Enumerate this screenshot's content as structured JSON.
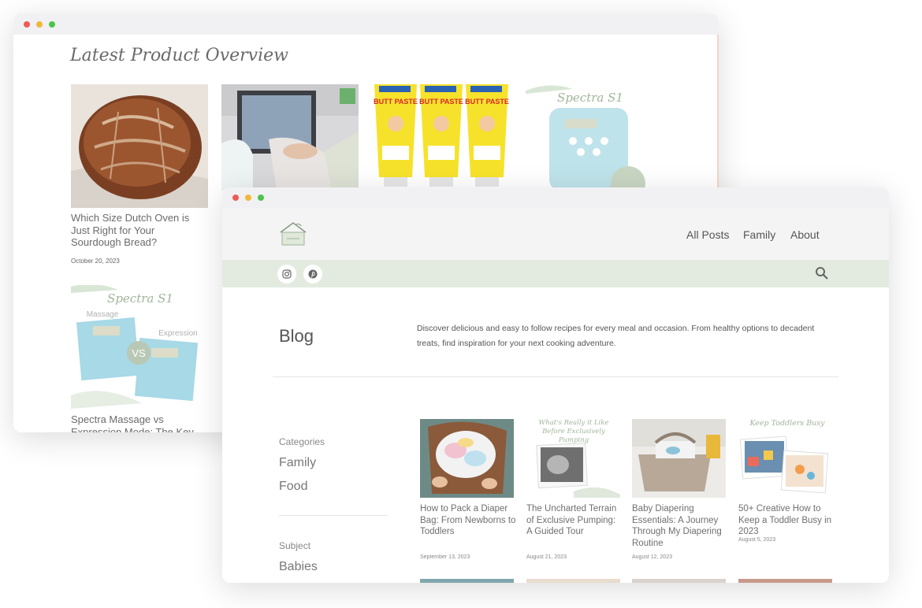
{
  "back_window": {
    "section_title": "Latest Product Overview",
    "posts": [
      {
        "title": "Which Size Dutch Oven is Just Right for Your Sourdough Bread?",
        "date": "October 20, 2023"
      },
      {
        "title": "Spectra Massage vs Expression Mode: The Key",
        "date": ""
      }
    ],
    "product_labels": {
      "spectra_heading": "Spectra S1",
      "massage_label": "Massage",
      "expression_label": "Expression",
      "vs_label": "VS",
      "tube_brand": "BOUDREAUX'S BUTT PASTE"
    }
  },
  "front_window": {
    "nav": {
      "items": [
        {
          "label": "All Posts"
        },
        {
          "label": "Family"
        },
        {
          "label": "About"
        }
      ]
    },
    "social": {
      "icons": [
        "instagram-icon",
        "pinterest-icon"
      ],
      "search_icon": "search-icon"
    },
    "blog": {
      "title": "Blog",
      "description": "Discover delicious and easy to follow recipes for every meal and occasion. From healthy options to decadent treats, find inspiration for your next cooking adventure."
    },
    "sidebar": {
      "categories_label": "Categories",
      "categories": [
        {
          "label": "Family"
        },
        {
          "label": "Food"
        }
      ],
      "subject_label": "Subject",
      "subjects": [
        {
          "label": "Babies"
        }
      ]
    },
    "posts": [
      {
        "title": "How to Pack a Diaper Bag: From Newborns to Toddlers",
        "date": "September 13, 2023"
      },
      {
        "title": "The Uncharted Terrain of Exclusive Pumping: A Guided Tour",
        "date": "August 21, 2023",
        "image_text": "What's Really it Like Before Exclusively Pumping"
      },
      {
        "title": "Baby Diapering Essentials: A Journey Through My Diapering Routine",
        "date": "August 12, 2023"
      },
      {
        "title": "50+ Creative How to Keep a Toddler Busy in 2023",
        "date": "August 5, 2023",
        "image_text": "Keep Toddlers Busy"
      }
    ]
  },
  "colors": {
    "social_bar": "#e3ebe0",
    "header_bg": "#f4f4f4",
    "accent_green": "#9fb59a",
    "text": "#555555"
  }
}
